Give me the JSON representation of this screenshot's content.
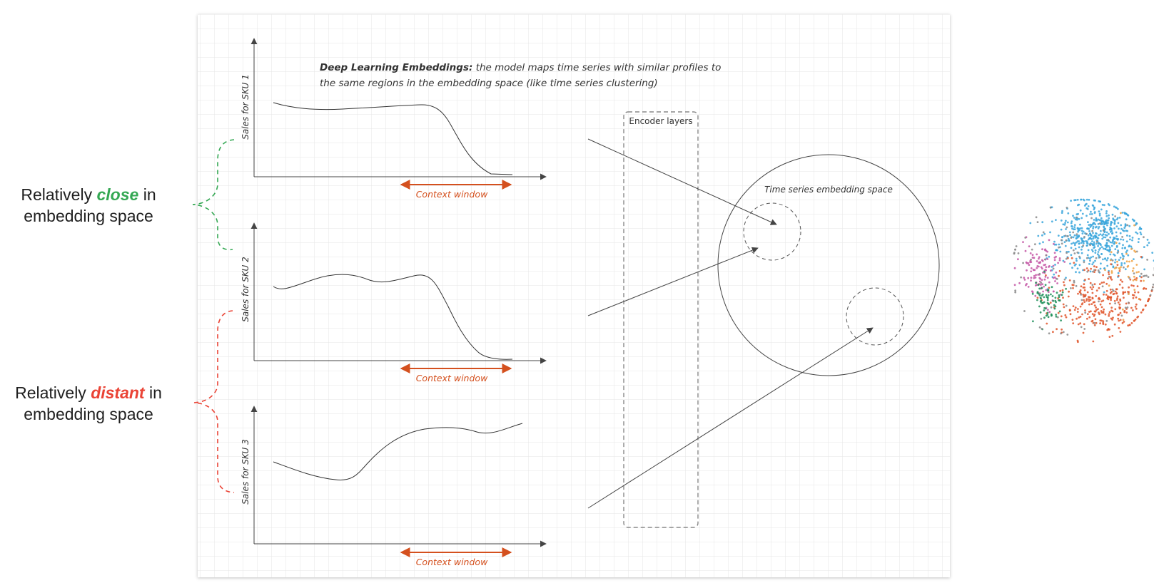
{
  "colors": {
    "accent_orange": "#d4501e",
    "close_green": "#34a853",
    "distant_red": "#ea4335",
    "grid_line": "#e6e6e6",
    "ink": "#333333"
  },
  "left_labels": {
    "close": {
      "pre": "Relatively ",
      "keyword": "close",
      "post": " in",
      "line2": "embedding space"
    },
    "distant": {
      "pre": "Relatively ",
      "keyword": "distant",
      "post": " in",
      "line2": "embedding space"
    }
  },
  "heading": {
    "bold": "Deep Learning Embeddings:",
    "rest_line1": " the model maps time series with similar profiles to",
    "line2": "the same regions in the embedding space (like time series clustering)"
  },
  "panels": [
    {
      "ylabel": "Sales for SKU 1",
      "context_label": "Context window"
    },
    {
      "ylabel": "Sales for SKU 2",
      "context_label": "Context window"
    },
    {
      "ylabel": "Sales for SKU 3",
      "context_label": "Context window"
    }
  ],
  "encoder": {
    "label": "Encoder layers"
  },
  "embedding_space": {
    "label": "Time series embedding space"
  },
  "icons": {
    "cluster_plot": "tsne-scatter-icon"
  }
}
